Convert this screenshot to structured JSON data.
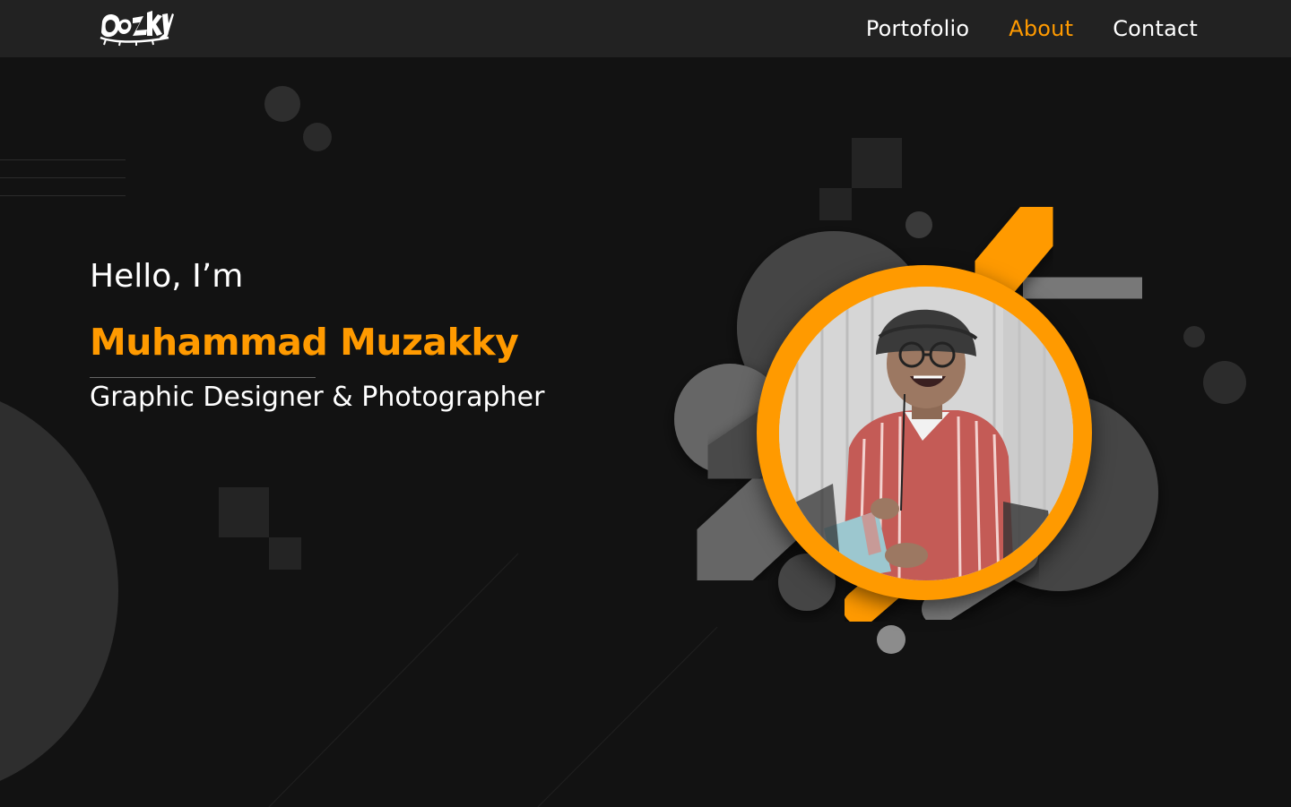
{
  "header": {
    "logo_icon": "dozzky-logo",
    "nav": [
      {
        "label": "Portofolio",
        "active": false
      },
      {
        "label": "About",
        "active": true
      },
      {
        "label": "Contact",
        "active": false
      }
    ]
  },
  "hero": {
    "greeting": "Hello, I’m",
    "name": "Muhammad Muzakky",
    "role": "Graphic Designer & Photographer"
  },
  "colors": {
    "accent": "#ff9a00",
    "background": "#121212",
    "header": "#222222",
    "shape_dark": "#444444",
    "shape_mid": "#5c5c5c",
    "shape_light": "#787878"
  }
}
